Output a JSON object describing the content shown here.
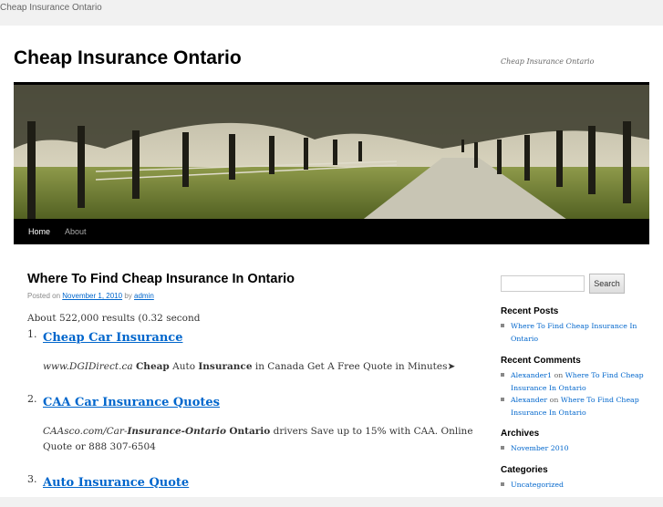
{
  "topbar": {
    "text": "Cheap Insurance Ontario"
  },
  "header": {
    "title": "Cheap Insurance Ontario",
    "tagline": "Cheap Insurance Ontario"
  },
  "nav": {
    "items": [
      {
        "label": "Home"
      },
      {
        "label": "About"
      }
    ]
  },
  "post": {
    "title": "Where To Find Cheap Insurance In Ontario",
    "meta_prefix": "Posted on",
    "date": "November 1, 2010",
    "meta_by": "by",
    "author": "admin",
    "results_text": "About 522,000 results (0.32 second",
    "items": [
      {
        "number": "1.",
        "title": "Cheap Car Insurance",
        "desc_url": "www.DGIDirect.ca",
        "desc_b1": "Cheap",
        "desc_t1": "Auto",
        "desc_b2": "Insurance",
        "desc_t2": "in Canada Get A Free Quote in Minutes",
        "arrow": "➤"
      },
      {
        "number": "2.",
        "title": "CAA Car Insurance Quotes",
        "desc_url1": "CAAsco.com/Car-",
        "desc_url2": "Insurance-Ontario",
        "desc_b1": "Ontario",
        "desc_t1": "drivers Save up to 15% with CAA. Online Quote or 888 307-6504"
      },
      {
        "number": "3.",
        "title": "Auto Insurance Quote"
      }
    ]
  },
  "sidebar": {
    "search_button": "Search",
    "search_placeholder": "",
    "recent_posts": {
      "title": "Recent Posts",
      "items": [
        "Where To Find Cheap Insurance In Ontario"
      ]
    },
    "recent_comments": {
      "title": "Recent Comments",
      "items": [
        {
          "author": "Alexander1",
          "on": "on",
          "post": "Where To Find Cheap Insurance In Ontario"
        },
        {
          "author": "Alexander",
          "on": "on",
          "post": "Where To Find Cheap Insurance In Ontario"
        }
      ]
    },
    "archives": {
      "title": "Archives",
      "items": [
        "November 2010"
      ]
    },
    "categories": {
      "title": "Categories",
      "items": [
        "Uncategorized"
      ]
    }
  },
  "colors": {
    "link": "#0066cc",
    "nav_bg": "#000000",
    "page_bg": "#f1f1f1"
  }
}
